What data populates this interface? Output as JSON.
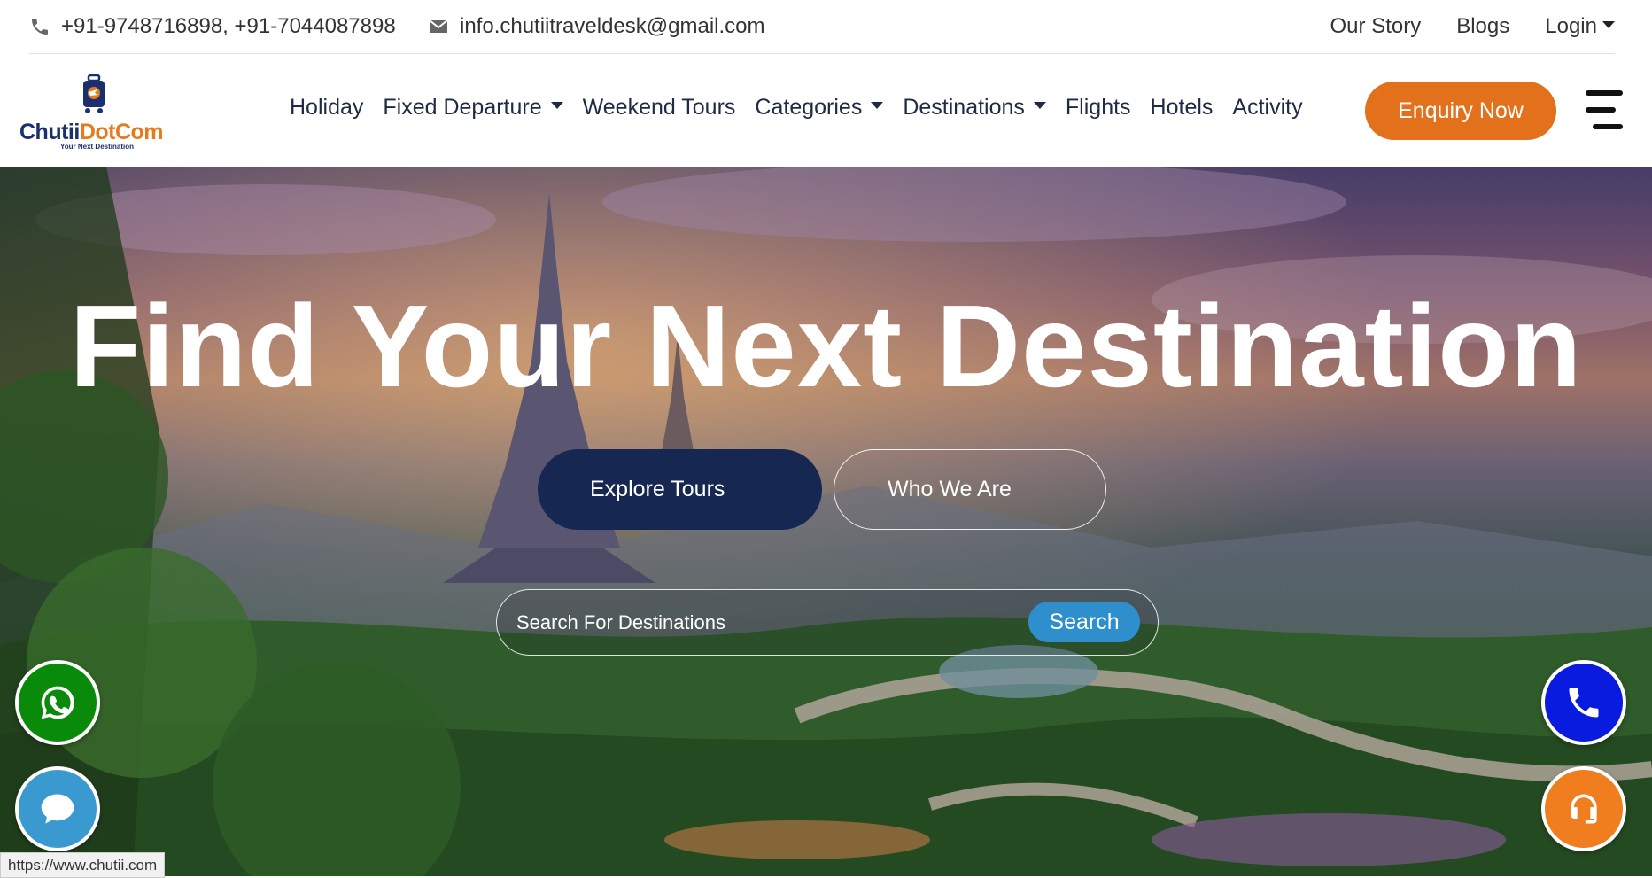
{
  "topbar": {
    "phone": "+91-9748716898, +91-7044087898",
    "email": "info.chutiitraveldesk@gmail.com",
    "links": [
      "Our Story",
      "Blogs",
      "Login"
    ]
  },
  "logo": {
    "name_part1": "Chutii",
    "name_part2": "DotCom",
    "tagline": "Your Next Destination"
  },
  "nav": {
    "items": [
      {
        "label": "Holiday",
        "dropdown": false
      },
      {
        "label": "Fixed Departure",
        "dropdown": true
      },
      {
        "label": "Weekend Tours",
        "dropdown": false
      },
      {
        "label": "Categories",
        "dropdown": true
      },
      {
        "label": "Destinations",
        "dropdown": true
      },
      {
        "label": "Flights",
        "dropdown": false
      },
      {
        "label": "Hotels",
        "dropdown": false
      },
      {
        "label": "Activity",
        "dropdown": false
      }
    ],
    "enquiry_label": "Enquiry Now"
  },
  "hero": {
    "title": "Find Your Next Destination",
    "explore_label": "Explore Tours",
    "who_label": "Who We Are",
    "search_placeholder": "Search For Destinations",
    "search_label": "Search"
  },
  "status_url": "https://www.chutii.com",
  "colors": {
    "accent_orange": "#e3711c",
    "navy": "#162852",
    "search_blue": "#2e8fcc",
    "whatsapp_green": "#0a8a0a",
    "chat_blue": "#3a9ad0",
    "phone_blue": "#0a1be0",
    "support_orange": "#f07d1e"
  }
}
